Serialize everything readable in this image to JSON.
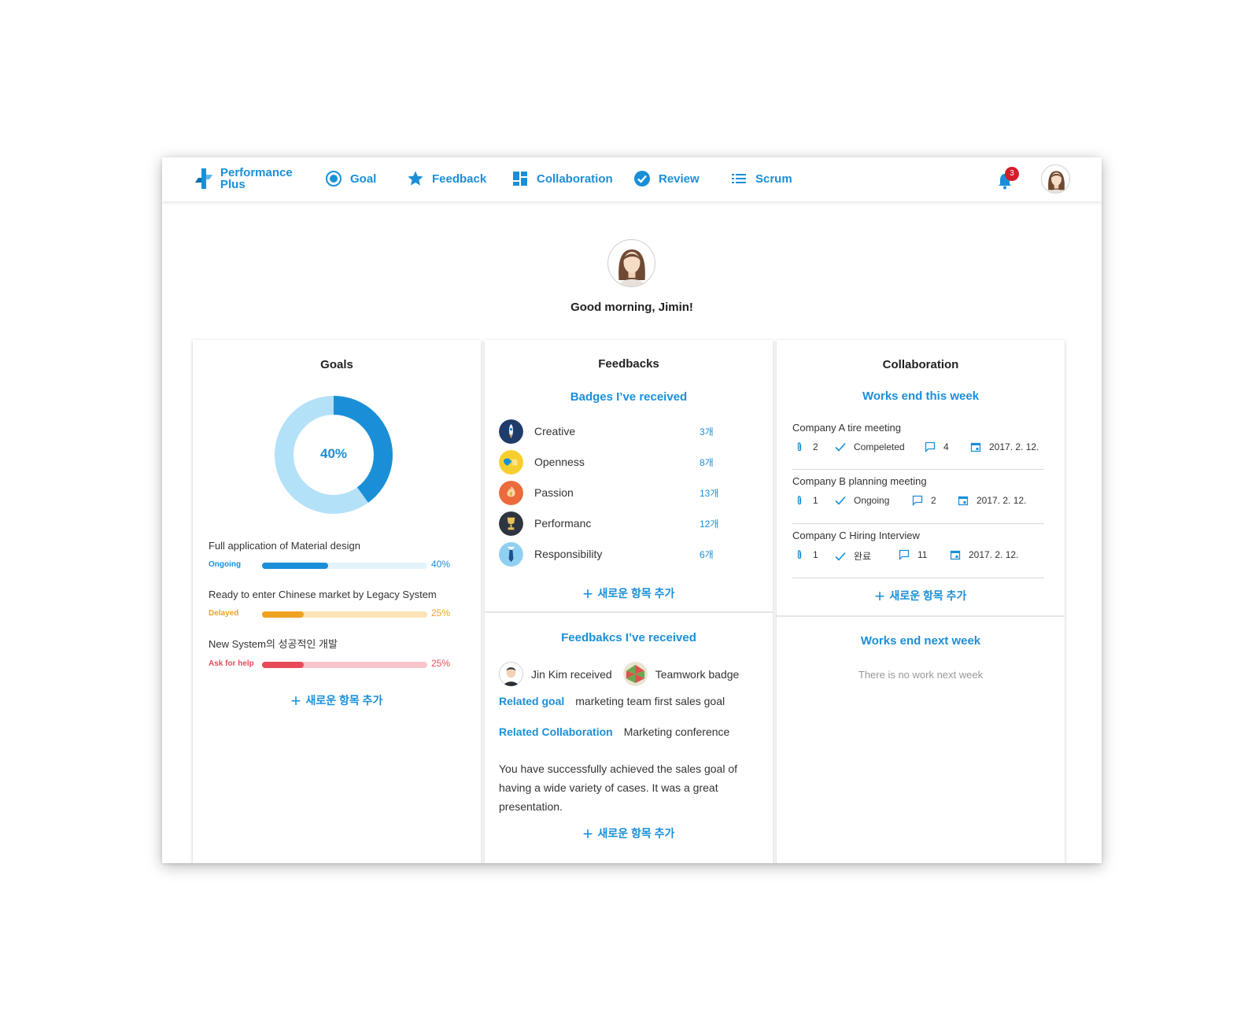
{
  "nav": {
    "brand_line1": "Performance",
    "brand_line2": "Plus",
    "items": [
      {
        "label": "Goal",
        "icon": "target-icon"
      },
      {
        "label": "Feedback",
        "icon": "star-icon"
      },
      {
        "label": "Collaboration",
        "icon": "dashboard-icon"
      },
      {
        "label": "Review",
        "icon": "check-circle-icon"
      },
      {
        "label": "Scrum",
        "icon": "list-icon"
      }
    ],
    "notification_count": "3",
    "accent_color": "#1a8fd8"
  },
  "hero": {
    "greeting": "Good morning, Jimin!"
  },
  "goals": {
    "title": "Goals",
    "overall_progress": 0.4,
    "overall_label": "40%",
    "items": [
      {
        "title": "Full application of Material design",
        "status": "Ongoing",
        "progress": 0.4,
        "pct_label": "40%",
        "color": "#1a8fd8",
        "track_color": "#e3f3fc"
      },
      {
        "title": "Ready to enter Chinese market by Legacy System",
        "status": "Delayed",
        "progress": 0.25,
        "pct_label": "25%",
        "color": "#f0a322",
        "track_color": "#fbe3b6"
      },
      {
        "title": "New System의 성공적인 개발",
        "status": "Ask  for help",
        "progress": 0.25,
        "pct_label": "25%",
        "color": "#e84a5a",
        "track_color": "#f8c6cc"
      }
    ],
    "add_label": "새로운 항목 추가"
  },
  "feedbacks": {
    "title": "Feedbacks",
    "badges_title": "Badges I’ve received",
    "badges": [
      {
        "name": "Creative",
        "count": "3개",
        "icon": "rocket-icon"
      },
      {
        "name": "Openness",
        "count": "8개",
        "icon": "open-hand-icon"
      },
      {
        "name": "Passion",
        "count": "13개",
        "icon": "fire-icon"
      },
      {
        "name": "Performanc",
        "count": "12개",
        "icon": "trophy-icon"
      },
      {
        "name": "Responsibility",
        "count": "6개",
        "icon": "necktie-icon"
      }
    ],
    "add_label": "새로운 항목 추가",
    "received_title": "Feedbakcs I’ve received",
    "received": {
      "person": "Jin Kim received",
      "badge": "Teamwork badge",
      "related_goal_label": "Related goal",
      "related_goal": "marketing team first sales goal",
      "related_collab_label": "Related Collaboration",
      "related_collab": "Marketing conference",
      "message": "You have successfully achieved the sales goal of having a wide variety of cases. It was a great presentation."
    },
    "add_label_2": "새로운 항목 추가"
  },
  "collaboration": {
    "title": "Collaboration",
    "this_week_title": "Works end this week",
    "works": [
      {
        "title": "Company A tire meeting",
        "attachments": "2",
        "status": "Compeleted",
        "comments": "4",
        "date": "2017. 2. 12."
      },
      {
        "title": "Company B planning meeting",
        "attachments": "1",
        "status": "Ongoing",
        "comments": "2",
        "date": "2017. 2. 12."
      },
      {
        "title": "Company C Hiring Interview",
        "attachments": "1",
        "status": "완료",
        "comments": "11",
        "date": "2017. 2. 12."
      }
    ],
    "add_label": "새로운 항목 추가",
    "next_week_title": "Works end next week",
    "next_week_empty": "There is no work next week"
  }
}
